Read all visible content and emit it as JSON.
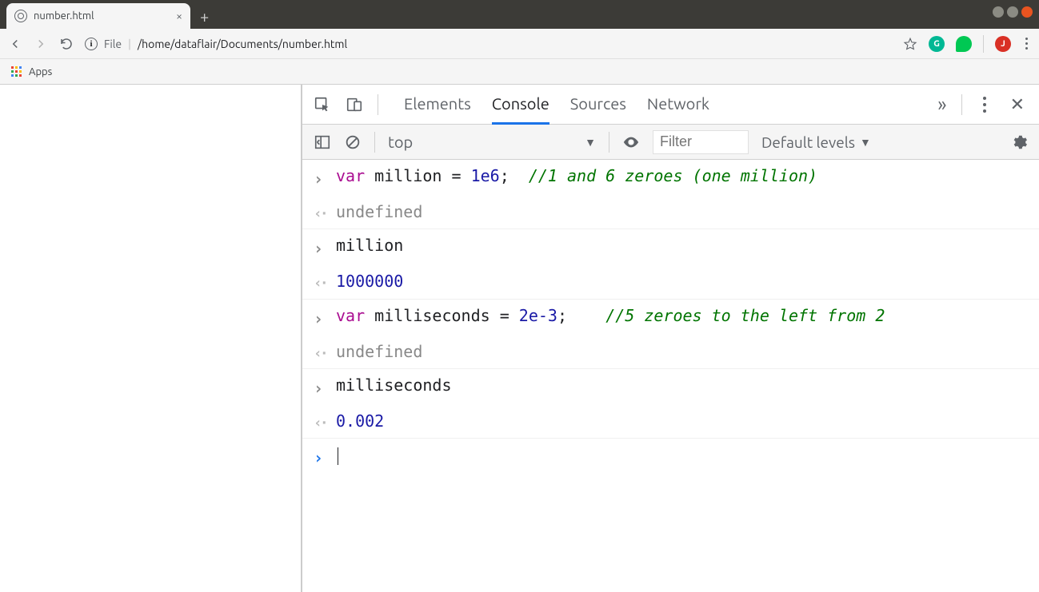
{
  "tab": {
    "title": "number.html"
  },
  "url": {
    "scheme_label": "File",
    "path": "/home/dataflair/Documents/number.html"
  },
  "bookmarks": {
    "apps_label": "Apps"
  },
  "devtools": {
    "tabs": {
      "elements": "Elements",
      "console": "Console",
      "sources": "Sources",
      "network": "Network"
    },
    "toolbar": {
      "context": "top",
      "filter_placeholder": "Filter",
      "levels_label": "Default levels"
    },
    "console_rows": [
      {
        "type": "in",
        "segments": [
          {
            "cls": "kw",
            "t": "var"
          },
          {
            "cls": "plain",
            "t": " million "
          },
          {
            "cls": "plain",
            "t": "= "
          },
          {
            "cls": "num",
            "t": "1e6"
          },
          {
            "cls": "plain",
            "t": ";  "
          },
          {
            "cls": "comment",
            "t": "//1 and 6 zeroes (one million)"
          }
        ]
      },
      {
        "type": "out",
        "segments": [
          {
            "cls": "undef",
            "t": "undefined"
          }
        ]
      },
      {
        "type": "in",
        "segments": [
          {
            "cls": "plain",
            "t": "million"
          }
        ]
      },
      {
        "type": "out",
        "segments": [
          {
            "cls": "num",
            "t": "1000000"
          }
        ]
      },
      {
        "type": "in",
        "segments": [
          {
            "cls": "kw",
            "t": "var"
          },
          {
            "cls": "plain",
            "t": " milliseconds "
          },
          {
            "cls": "plain",
            "t": "= "
          },
          {
            "cls": "num",
            "t": "2e-3"
          },
          {
            "cls": "plain",
            "t": ";    "
          },
          {
            "cls": "comment",
            "t": "//5 zeroes to the left from 2"
          }
        ]
      },
      {
        "type": "out",
        "segments": [
          {
            "cls": "undef",
            "t": "undefined"
          }
        ]
      },
      {
        "type": "in",
        "segments": [
          {
            "cls": "plain",
            "t": "milliseconds"
          }
        ]
      },
      {
        "type": "out",
        "segments": [
          {
            "cls": "num",
            "t": "0.002"
          }
        ]
      }
    ]
  },
  "extensions": {
    "avatar_letter": "J"
  }
}
